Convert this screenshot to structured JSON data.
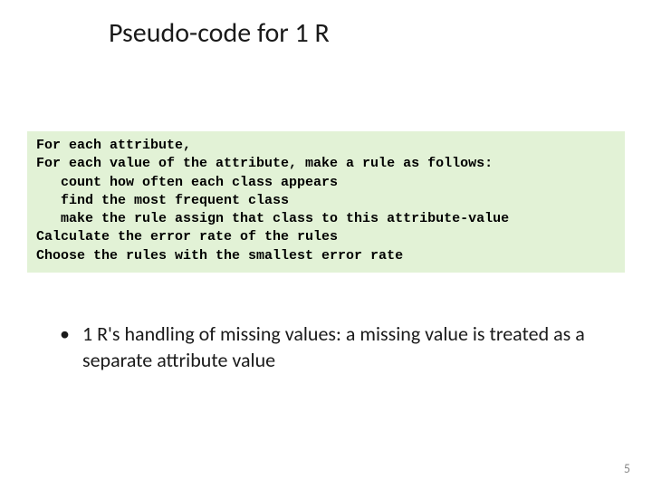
{
  "title": "Pseudo-code for 1 R",
  "code_lines": [
    "For each attribute,",
    "For each value of the attribute, make a rule as follows:",
    "   count how often each class appears",
    "   find the most frequent class",
    "   make the rule assign that class to this attribute-value",
    "Calculate the error rate of the rules",
    "Choose the rules with the smallest error rate"
  ],
  "bullet": {
    "marker": "•",
    "text": "1 R's handling of missing values: a missing value is treated as a separate attribute value"
  },
  "page_number": "5"
}
